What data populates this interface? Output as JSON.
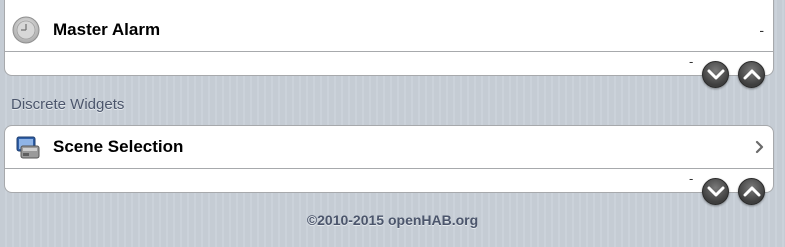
{
  "alarm_group": {
    "master_alarm": {
      "label": "Master Alarm",
      "value": "-"
    },
    "trailing_value": "-"
  },
  "discrete_widgets": {
    "section_title": "Discrete Widgets",
    "scene_selection": {
      "label": "Scene Selection"
    },
    "trailing_value": "-"
  },
  "footer": {
    "text": "©2010-2015 openHAB.org"
  },
  "icons": {
    "clock": "clock-icon",
    "scene": "scene-selection-icon",
    "chevron": "chevron-right-icon",
    "down": "scroll-down-button",
    "up": "scroll-up-button"
  },
  "colors": {
    "background": "#c5ccd4",
    "section_text": "#4c566c",
    "accent_blue": "#2f69c4"
  }
}
